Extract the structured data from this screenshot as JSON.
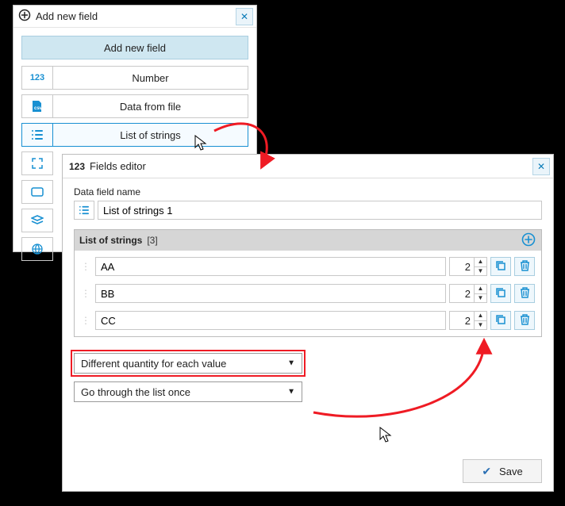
{
  "addPanel": {
    "title": "Add new field",
    "headerBtn": "Add new field",
    "types": {
      "number": "Number",
      "dataFile": "Data from file",
      "listStrings": "List of strings"
    }
  },
  "editor": {
    "title": "Fields editor",
    "nameLabel": "Data field name",
    "nameValue": "List of strings 1",
    "listTitle": "List of strings",
    "listCount": "[3]",
    "rows": [
      {
        "value": "AA",
        "qty": "2"
      },
      {
        "value": "BB",
        "qty": "2"
      },
      {
        "value": "CC",
        "qty": "2"
      }
    ],
    "select1": "Different quantity for each value",
    "select2": "Go through the list once",
    "save": "Save"
  },
  "icons": {
    "numberGlyph": "123",
    "csvGlyph": "csv"
  }
}
